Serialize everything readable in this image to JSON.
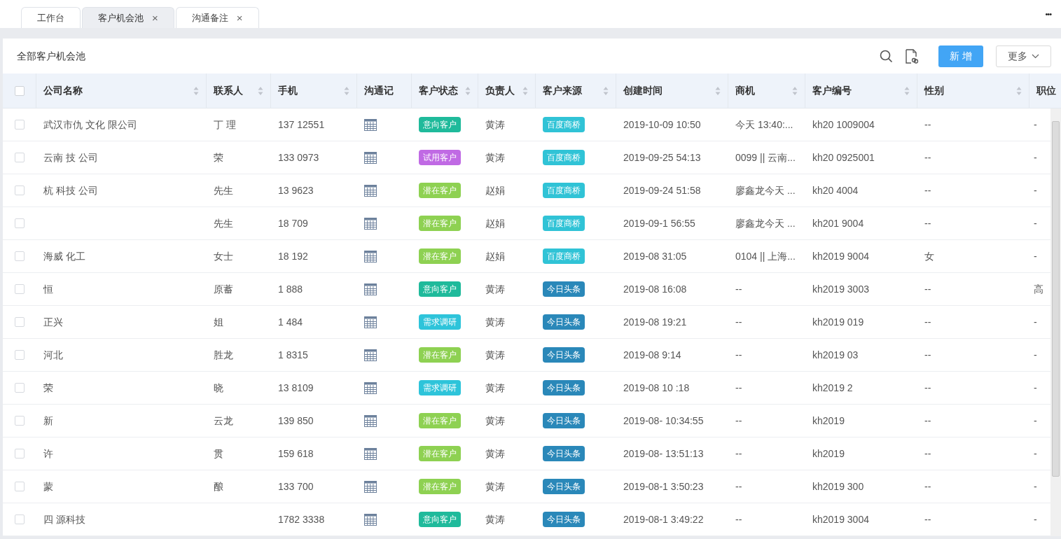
{
  "tabs": [
    {
      "label": "工作台",
      "selected": false
    },
    {
      "label": "客户机会池",
      "selected": true,
      "close": "×"
    },
    {
      "label": "沟通备注",
      "selected": false,
      "close": "×"
    }
  ],
  "more_menu": "•••",
  "panel": {
    "title": "全部客户机会池",
    "add_button": "新 增",
    "more_button": "更多"
  },
  "table": {
    "select_all_checked": false,
    "columns": [
      {
        "label": "公司名称",
        "sortable": true
      },
      {
        "label": "联系人",
        "sortable": true
      },
      {
        "label": "手机",
        "sortable": true
      },
      {
        "label": "沟通记",
        "sortable": false
      },
      {
        "label": "客户状态",
        "sortable": true
      },
      {
        "label": "负责人",
        "sortable": true
      },
      {
        "label": "客户来源",
        "sortable": true
      },
      {
        "label": "创建时间",
        "sortable": true
      },
      {
        "label": "商机",
        "sortable": true
      },
      {
        "label": "客户编号",
        "sortable": true
      },
      {
        "label": "性别",
        "sortable": true
      },
      {
        "label": "职位",
        "sortable": false
      }
    ],
    "rows": [
      {
        "checked": false,
        "company": "武汉市仇 文化 限公司",
        "contact": "丁 理",
        "phone": "137 12551",
        "status": {
          "label": "意向客户",
          "color": "#1fba9b"
        },
        "owner": "黄涛",
        "source": {
          "label": "百度商桥",
          "color": "#30c3d6"
        },
        "created": "2019-10-09 10:50",
        "opportunity": "今天 13:40:...",
        "code": "kh20 1009004",
        "gender": "--",
        "position": "-"
      },
      {
        "checked": false,
        "company": "云南 技 公司",
        "contact": "荣",
        "phone": "133 0973",
        "status": {
          "label": "试用客户",
          "color": "#c06ae4"
        },
        "owner": "黄涛",
        "source": {
          "label": "百度商桥",
          "color": "#30c3d6"
        },
        "created": "2019-09-25 54:13",
        "opportunity": "0099 || 云南...",
        "code": "kh20 0925001",
        "gender": "--",
        "position": "-"
      },
      {
        "checked": false,
        "company": "杭 科技 公司",
        "contact": "先生",
        "phone": "13 9623",
        "status": {
          "label": "潜在客户",
          "color": "#8ed152"
        },
        "owner": "赵娟",
        "source": {
          "label": "百度商桥",
          "color": "#30c3d6"
        },
        "created": "2019-09-24 51:58",
        "opportunity": "廖鑫龙今天 ...",
        "code": "kh20 4004",
        "gender": "--",
        "position": "-"
      },
      {
        "checked": false,
        "company": "",
        "contact": "先生",
        "phone": "18 709",
        "status": {
          "label": "潜在客户",
          "color": "#8ed152"
        },
        "owner": "赵娟",
        "source": {
          "label": "百度商桥",
          "color": "#30c3d6"
        },
        "created": "2019-09-1 56:55",
        "opportunity": "廖鑫龙今天 ...",
        "code": "kh201 9004",
        "gender": "--",
        "position": "-"
      },
      {
        "checked": false,
        "company": "海威 化工",
        "contact": "女士",
        "phone": "18 192",
        "status": {
          "label": "潜在客户",
          "color": "#8ed152"
        },
        "owner": "赵娟",
        "source": {
          "label": "百度商桥",
          "color": "#30c3d6"
        },
        "created": "2019-08 31:05",
        "opportunity": "0104 || 上海...",
        "code": "kh2019 9004",
        "gender": "女",
        "position": "-"
      },
      {
        "checked": false,
        "company": "恒",
        "contact": "原蓄",
        "phone": "1 888",
        "status": {
          "label": "意向客户",
          "color": "#1fba9b"
        },
        "owner": "黄涛",
        "source": {
          "label": "今日头条",
          "color": "#2a88b9"
        },
        "created": "2019-08 16:08",
        "opportunity": "--",
        "code": "kh2019 3003",
        "gender": "--",
        "position": "高"
      },
      {
        "checked": false,
        "company": "正兴",
        "contact": "姐",
        "phone": "1 484",
        "status": {
          "label": "需求调研",
          "color": "#2ec4da"
        },
        "owner": "黄涛",
        "source": {
          "label": "今日头条",
          "color": "#2a88b9"
        },
        "created": "2019-08 19:21",
        "opportunity": "--",
        "code": "kh2019 019",
        "gender": "--",
        "position": "-"
      },
      {
        "checked": false,
        "company": "河北",
        "contact": "胜龙",
        "phone": "1 8315",
        "status": {
          "label": "潜在客户",
          "color": "#8ed152"
        },
        "owner": "黄涛",
        "source": {
          "label": "今日头条",
          "color": "#2a88b9"
        },
        "created": "2019-08 9:14",
        "opportunity": "--",
        "code": "kh2019 03",
        "gender": "--",
        "position": "-"
      },
      {
        "checked": false,
        "company": "荣",
        "contact": "晓",
        "phone": "13 8109",
        "status": {
          "label": "需求调研",
          "color": "#2ec4da"
        },
        "owner": "黄涛",
        "source": {
          "label": "今日头条",
          "color": "#2a88b9"
        },
        "created": "2019-08 10 :18",
        "opportunity": "--",
        "code": "kh2019 2",
        "gender": "--",
        "position": "-"
      },
      {
        "checked": false,
        "company": "新",
        "contact": "云龙",
        "phone": "139 850",
        "status": {
          "label": "潜在客户",
          "color": "#8ed152"
        },
        "owner": "黄涛",
        "source": {
          "label": "今日头条",
          "color": "#2a88b9"
        },
        "created": "2019-08- 10:34:55",
        "opportunity": "--",
        "code": "kh2019",
        "gender": "--",
        "position": "-"
      },
      {
        "checked": false,
        "company": "许",
        "contact": "贯",
        "phone": "159 618",
        "status": {
          "label": "潜在客户",
          "color": "#8ed152"
        },
        "owner": "黄涛",
        "source": {
          "label": "今日头条",
          "color": "#2a88b9"
        },
        "created": "2019-08- 13:51:13",
        "opportunity": "--",
        "code": "kh2019",
        "gender": "--",
        "position": "-"
      },
      {
        "checked": false,
        "company": "蒙",
        "contact": "酿",
        "phone": "133 700",
        "status": {
          "label": "潜在客户",
          "color": "#8ed152"
        },
        "owner": "黄涛",
        "source": {
          "label": "今日头条",
          "color": "#2a88b9"
        },
        "created": "2019-08-1 3:50:23",
        "opportunity": "--",
        "code": "kh2019 300",
        "gender": "--",
        "position": "-"
      },
      {
        "checked": false,
        "company": "四 源科技",
        "contact": "",
        "phone": "1782 3338",
        "status": {
          "label": "意向客户",
          "color": "#1fba9b"
        },
        "owner": "黄涛",
        "source": {
          "label": "今日头条",
          "color": "#2a88b9"
        },
        "created": "2019-08-1 3:49:22",
        "opportunity": "--",
        "code": "kh2019 3004",
        "gender": "--",
        "position": "-"
      }
    ]
  }
}
